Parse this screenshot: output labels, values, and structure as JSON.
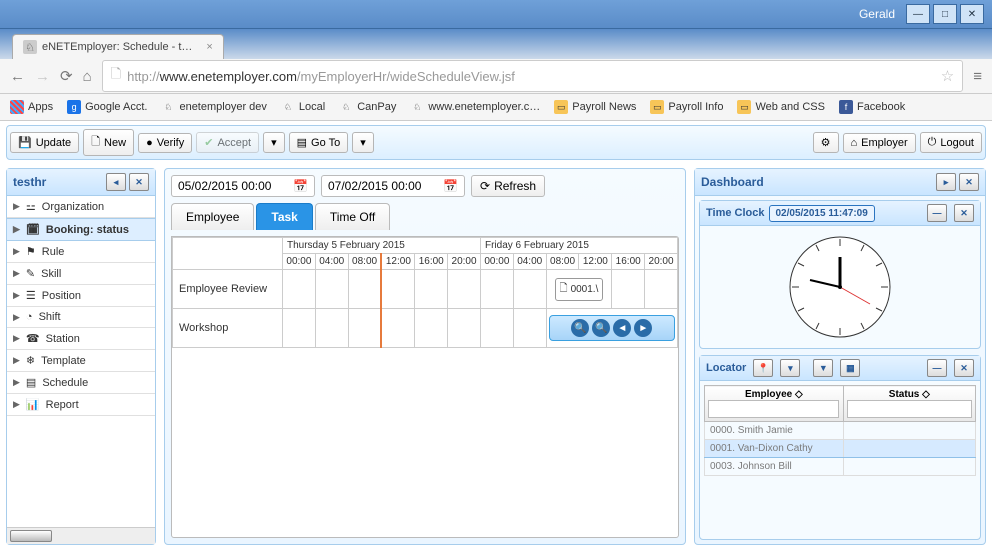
{
  "window": {
    "user": "Gerald"
  },
  "tab": {
    "title": "eNETEmployer: Schedule - t…"
  },
  "url": {
    "protocol": "http://",
    "host": "www.enetemployer.com",
    "path": "/myEmployerHr/wideScheduleView.jsf"
  },
  "bookmarks": {
    "apps": "Apps",
    "google": "Google Acct.",
    "dev": "enetemployer dev",
    "local": "Local",
    "canpay": "CanPay",
    "enet": "www.enetemployer.c…",
    "payrollnews": "Payroll News",
    "payrollinfo": "Payroll Info",
    "webcss": "Web and CSS",
    "facebook": "Facebook"
  },
  "toolbar": {
    "update": "Update",
    "new": "New",
    "verify": "Verify",
    "accept": "Accept",
    "goto": "Go To",
    "employer": "Employer",
    "logout": "Logout"
  },
  "sidebar": {
    "title": "testhr",
    "selected": "Booking: status",
    "items": [
      "Organization",
      "Booking: status",
      "Rule",
      "Skill",
      "Position",
      "Shift",
      "Station",
      "Template",
      "Schedule",
      "Report"
    ]
  },
  "center": {
    "from": "05/02/2015 00:00",
    "to": "07/02/2015 00:00",
    "refresh": "Refresh",
    "tabs": [
      "Employee",
      "Task",
      "Time Off"
    ],
    "activeTab": "Task",
    "days": [
      "Thursday 5 February 2015",
      "Friday 6 February 2015"
    ],
    "hours": [
      "00:00",
      "04:00",
      "08:00",
      "12:00",
      "16:00",
      "20:00"
    ],
    "rows": [
      "Employee Review",
      "Workshop"
    ],
    "event": "0001.\\"
  },
  "dashboard": {
    "title": "Dashboard",
    "timeclock": {
      "title": "Time Clock",
      "time": "02/05/2015 11:47:09"
    },
    "locator": {
      "title": "Locator",
      "cols": [
        "Employee",
        "Status"
      ],
      "rows": [
        {
          "emp": "0000. Smith Jamie",
          "status": ""
        },
        {
          "emp": "0001. Van-Dixon Cathy",
          "status": ""
        },
        {
          "emp": "0003. Johnson Bill",
          "status": ""
        }
      ],
      "selected": 1
    }
  }
}
